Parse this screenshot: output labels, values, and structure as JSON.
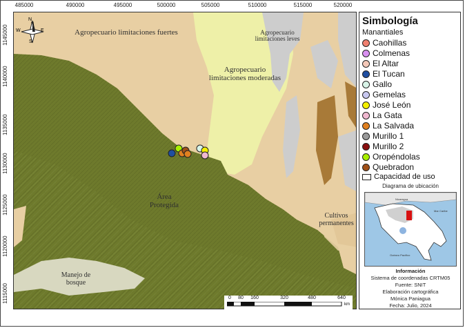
{
  "map": {
    "x_ticks": [
      "485000",
      "490000",
      "495000",
      "500000",
      "505000",
      "510000",
      "515000",
      "520000"
    ],
    "y_ticks": [
      "1145000",
      "1140000",
      "1135000",
      "1130000",
      "1125000",
      "1120000",
      "1115000"
    ],
    "zones": {
      "agro_fuertes": "Agropecuario limitaciones fuertes",
      "agro_leves": "Agropecuario limitaciones leves",
      "agro_moderadas": "Agropecuario limitaciones moderadas",
      "area_protegida": "Área Protegida",
      "cultivos": "Cultivos permanentes",
      "manejo": "Manejo de bosque"
    },
    "colors": {
      "protegida": "#6e7a2c",
      "fuertes": "#e8cfa3",
      "moderadas": "#eef0a8",
      "leves": "#cdcdcd",
      "cultivos": "#a87a38",
      "manejo": "#d8d8c0",
      "water": "#c8d6a0"
    },
    "north": {
      "n": "N",
      "s": "S",
      "e": "E",
      "w": "W"
    }
  },
  "legend": {
    "title": "Simbología",
    "subtitle": "Manantiales",
    "items": [
      {
        "label": "Caohillas",
        "color": "#f08070"
      },
      {
        "label": "Colmenas",
        "color": "#d890f0"
      },
      {
        "label": "El Altar",
        "color": "#f4c8b8"
      },
      {
        "label": "El Tucan",
        "color": "#1f4ea0"
      },
      {
        "label": "Gallo",
        "color": "#d8f4e8"
      },
      {
        "label": "Gemelas",
        "color": "#c8c8f0"
      },
      {
        "label": "José León",
        "color": "#f4f000"
      },
      {
        "label": "La Gata",
        "color": "#f0b8d0"
      },
      {
        "label": "La Salvada",
        "color": "#e08020"
      },
      {
        "label": "Murillo 1",
        "color": "#9a9a9a"
      },
      {
        "label": "Murillo 2",
        "color": "#8a1010"
      },
      {
        "label": "Oropéndolas",
        "color": "#a8f000"
      },
      {
        "label": "Quebradon",
        "color": "#a05018"
      }
    ],
    "capacity_label": "Capacidad de uso"
  },
  "inset": {
    "title": "Diagrama de ubicación",
    "labels": {
      "nicaragua": "Nicaragua",
      "caribe": "Mar Caribe",
      "pacifico": "Océano Pacífico"
    }
  },
  "info": {
    "heading": "Información",
    "lines": [
      "Sistema de coordenadas CRTM05",
      "Fuente: SNIT",
      "Elaboración cartográfica",
      "Mónica Paniagua",
      "Fecha: Julio, 2024"
    ]
  },
  "scalebar": {
    "labels": [
      "0",
      "80",
      "160",
      "320",
      "480",
      "640"
    ],
    "unit": "km"
  }
}
